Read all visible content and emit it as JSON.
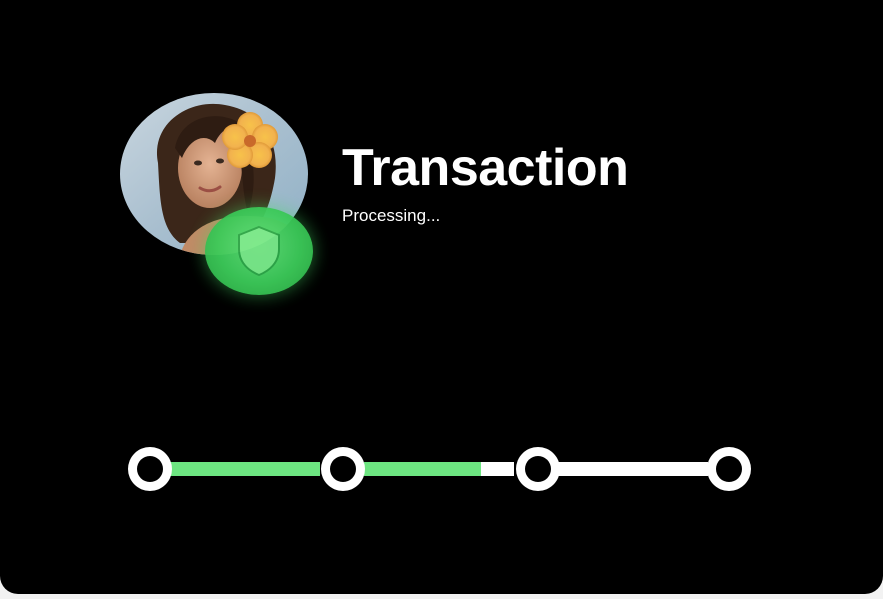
{
  "transaction": {
    "title": "Transaction",
    "status": "Processing..."
  },
  "avatar": {
    "icon": "user-photo"
  },
  "badge": {
    "icon": "shield-icon",
    "color": "#3ccb59"
  },
  "progress": {
    "steps": 4,
    "connectors": [
      {
        "fill": 1.0
      },
      {
        "fill": 0.78
      },
      {
        "fill": 0.0
      }
    ],
    "fill_color": "#6de581",
    "track_color": "#ffffff"
  }
}
